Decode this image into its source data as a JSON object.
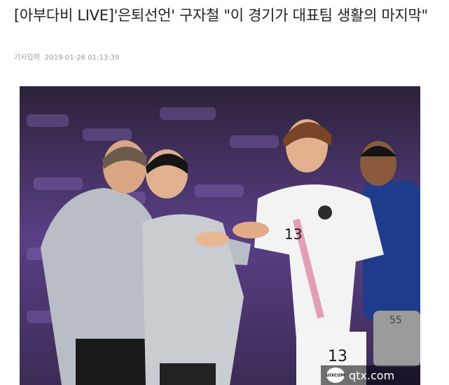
{
  "article": {
    "title": "[아부다비 LIVE]'은퇴선언' 구자철 \"이 경기가 대표팀 생활의 마지막\"",
    "meta_label": "기사입력",
    "meta_datetime": "2019-01-26 01:13:39"
  },
  "photo": {
    "jersey_number_chest": "13",
    "jersey_number_shorts": "13"
  },
  "watermark": {
    "logo_text": "UIXCOM",
    "site": "qtx.com"
  }
}
